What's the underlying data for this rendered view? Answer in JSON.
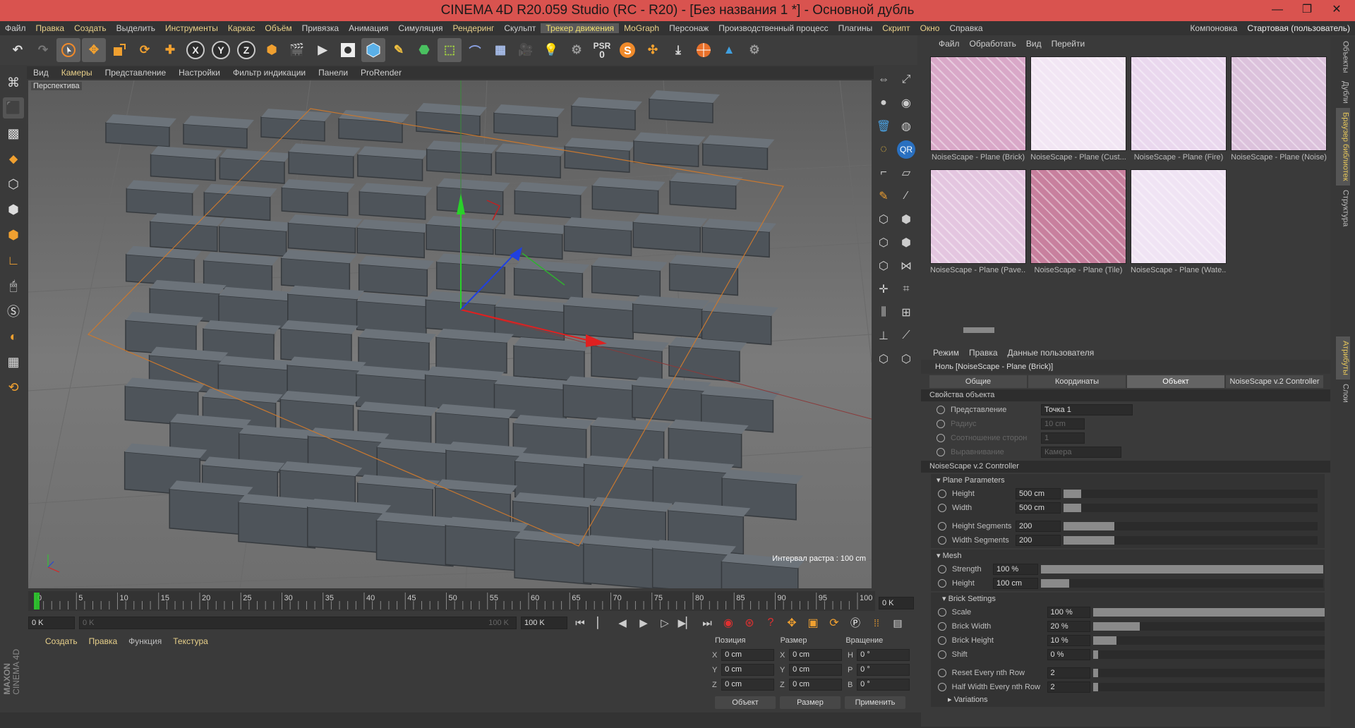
{
  "window": {
    "title": "CINEMA 4D R20.059 Studio (RC - R20) - [Без названия 1 *] - Основной дубль"
  },
  "menubar": {
    "items": [
      "Файл",
      "Правка",
      "Создать",
      "Выделить",
      "Инструменты",
      "Каркас",
      "Объём",
      "Привязка",
      "Анимация",
      "Симуляция",
      "Рендеринг",
      "Скульпт",
      "Трекер движения",
      "MoGraph",
      "Персонаж",
      "Производственный процесс",
      "Плагины",
      "Скрипт",
      "Окно",
      "Справка"
    ],
    "layout_label": "Компоновка",
    "layout_value": "Стартовая (пользователь)"
  },
  "toolbar": {
    "x": "X",
    "y": "Y",
    "z": "Z",
    "psr": "PSR",
    "psr_val": "0"
  },
  "viewport": {
    "menu": [
      "Вид",
      "Камеры",
      "Представление",
      "Настройки",
      "Фильтр индикации",
      "Панели",
      "ProRender"
    ],
    "label": "Перспектива",
    "grid_info": "Интервал растра : 100 cm"
  },
  "timeline": {
    "ticks": [
      "0",
      "5",
      "10",
      "15",
      "20",
      "25",
      "30",
      "35",
      "40",
      "45",
      "50",
      "55",
      "60",
      "65",
      "70",
      "75",
      "80",
      "85",
      "90",
      "95",
      "100"
    ],
    "current": "0 K",
    "start": "0 K",
    "range_start": "0 K",
    "range_end": "100 K",
    "end": "100 K"
  },
  "material": {
    "menu": [
      "Создать",
      "Правка",
      "Функция",
      "Текстура"
    ]
  },
  "coords": {
    "headers": [
      "Позиция",
      "Размер",
      "Вращение"
    ],
    "rows": [
      {
        "a": "X",
        "p": "0 cm",
        "sa": "X",
        "s": "0 cm",
        "ra": "H",
        "r": "0 °"
      },
      {
        "a": "Y",
        "p": "0 cm",
        "sa": "Y",
        "s": "0 cm",
        "ra": "P",
        "r": "0 °"
      },
      {
        "a": "Z",
        "p": "0 cm",
        "sa": "Z",
        "s": "0 cm",
        "ra": "B",
        "r": "0 °"
      }
    ],
    "mode1": "Объект",
    "mode2": "Размер",
    "apply": "Применить"
  },
  "browser": {
    "menu": [
      "Файл",
      "Обработать",
      "Вид",
      "Перейти"
    ],
    "items": [
      {
        "label": "NoiseScape - Plane (Brick)",
        "color": "#d9a8c8"
      },
      {
        "label": "NoiseScape - Plane (Cust...",
        "color": "#f2e6f4"
      },
      {
        "label": "NoiseScape - Plane (Fire)",
        "color": "#ead8ee"
      },
      {
        "label": "NoiseScape - Plane (Noise)",
        "color": "#dcc2dc"
      },
      {
        "label": "NoiseScape - Plane (Pave...",
        "color": "#e4c6e0"
      },
      {
        "label": "NoiseScape - Plane (Tile)",
        "color": "#c8809e"
      },
      {
        "label": "NoiseScape - Plane (Wate...",
        "color": "#f0e4f4"
      }
    ]
  },
  "attributes": {
    "menu": [
      "Режим",
      "Правка",
      "Данные пользователя"
    ],
    "object_name": "Ноль [NoiseScape - Plane (Brick)]",
    "tabs": [
      "Общие",
      "Координаты",
      "Объект",
      "NoiseScape v.2 Controller"
    ],
    "active_tab": 2,
    "props_header": "Свойства объекта",
    "props": [
      {
        "label": "Представление",
        "value": "Точка 1",
        "disabled": false
      },
      {
        "label": "Радиус",
        "value": "10 cm",
        "disabled": true
      },
      {
        "label": "Соотношение сторон",
        "value": "1",
        "disabled": true
      },
      {
        "label": "Выравнивание",
        "value": "Камера",
        "disabled": true
      }
    ],
    "controller_header": "NoiseScape v.2 Controller",
    "plane_params": "Plane Parameters",
    "plane": [
      {
        "label": "Height",
        "value": "500 cm",
        "fill": 0.07
      },
      {
        "label": "Width",
        "value": "500 cm",
        "fill": 0.07
      },
      {
        "label": "Height Segments",
        "value": "200",
        "fill": 0.2
      },
      {
        "label": "Width Segments",
        "value": "200",
        "fill": 0.2
      }
    ],
    "mesh_header": "Mesh",
    "mesh": [
      {
        "label": "Strength",
        "value": "100 %",
        "fill": 1.0
      },
      {
        "label": "Height",
        "value": "100 cm",
        "fill": 0.1
      }
    ],
    "brick_header": "Brick Settings",
    "brick": [
      {
        "label": "Scale",
        "value": "100 %",
        "fill": 1.0
      },
      {
        "label": "Brick Width",
        "value": "20 %",
        "fill": 0.2
      },
      {
        "label": "Brick Height",
        "value": "10 %",
        "fill": 0.1
      },
      {
        "label": "Shift",
        "value": "0 %",
        "fill": 0.0
      },
      {
        "label": "Reset Every nth Row",
        "value": "2",
        "fill": 0.02
      },
      {
        "label": "Half Width Every nth Row",
        "value": "2",
        "fill": 0.02
      }
    ],
    "variations": "Variations"
  },
  "side_tabs": [
    "Объекты",
    "Дубли",
    "Браузер библиотек",
    "Структура",
    "Атрибуты",
    "Слои"
  ],
  "branding": {
    "line1": "MAXON",
    "line2": "CINEMA 4D"
  }
}
